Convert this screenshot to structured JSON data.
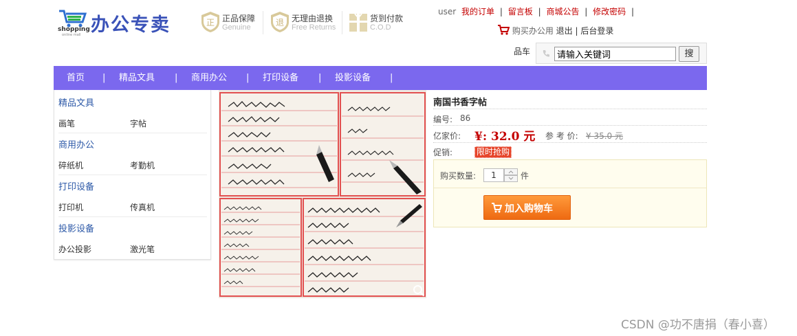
{
  "logo": {
    "text": "办公专卖",
    "shop_text": "shopping",
    "shop_sub": "online mall"
  },
  "guarantees": [
    {
      "icon": "shield-icon",
      "title": "正品保障",
      "sub": "Genuine"
    },
    {
      "icon": "return-icon",
      "title": "无理由退换",
      "sub": "Free Returns"
    },
    {
      "icon": "gift-icon",
      "title": "货到付款",
      "sub": "C.O.D"
    }
  ],
  "top_links": {
    "user": "user",
    "orders": "我的订单",
    "sep": "|",
    "guestbook": "留言板",
    "notice": "商城公告",
    "password": "修改密码"
  },
  "cart_line": {
    "cart_label": "购买办公用",
    "logout": "退出",
    "admin": "后台登录",
    "sep": "|"
  },
  "search": {
    "label": "品车",
    "value": "请输入关键词",
    "button": "搜"
  },
  "nav": {
    "items": [
      "首页",
      "精品文具",
      "商用办公",
      "打印设备",
      "投影设备"
    ],
    "sep": "|"
  },
  "sidebar": {
    "categories": [
      {
        "title": "精品文具",
        "subs": [
          "画笔",
          "字帖"
        ]
      },
      {
        "title": "商用办公",
        "subs": [
          "碎纸机",
          "考勤机"
        ]
      },
      {
        "title": "打印设备",
        "subs": [
          "打印机",
          "传真机"
        ]
      },
      {
        "title": "投影设备",
        "subs": [
          "办公投影",
          "激光笔"
        ]
      }
    ]
  },
  "product": {
    "title": "南国书香字帖",
    "id_label": "编号:",
    "id_value": "86",
    "price_label": "亿家价:",
    "price": "¥: 32.0 元",
    "ref_label": "参 考 价:",
    "ref_price": "¥ 35.0 元",
    "promo_label": "促销:",
    "promo_badge": "限时抢购",
    "qty_label": "购买数量:",
    "qty_value": "1",
    "qty_unit": "件",
    "add_cart": "加入购物车"
  },
  "watermark": "CSDN @功不唐捐（春小喜）",
  "colors": {
    "nav_bg": "#7b68ee",
    "accent_red": "#c40000",
    "button_orange": "#f07b1f",
    "category_blue": "#2e5aa8"
  }
}
